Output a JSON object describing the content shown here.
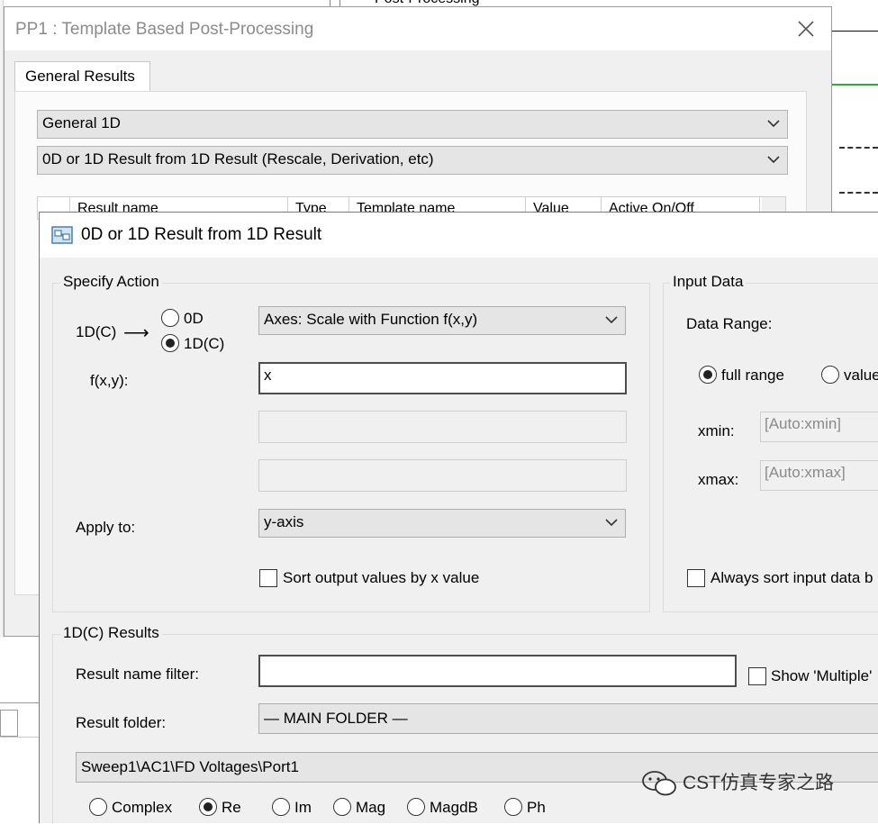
{
  "background": {
    "tree_item": "Post-Processing"
  },
  "pp1": {
    "title": "PP1 : Template Based Post-Processing",
    "tab": "General Results",
    "combo_category": "General 1D",
    "combo_template": "0D or 1D Result from 1D Result (Rescale, Derivation, etc)",
    "grid_columns": [
      "Result name",
      "Type",
      "Template name",
      "Value",
      "Active On/Off"
    ]
  },
  "dialog": {
    "title": "0D or 1D Result from 1D Result",
    "specify_action": {
      "legend": "Specify Action",
      "type_label": "1D(C)",
      "arrow": "⟶",
      "radio_0d": "0D",
      "radio_1dc": "1D(C)",
      "action_value": "Axes: Scale with Function f(x,y)",
      "fxy_label": "f(x,y):",
      "fxy_value": "x",
      "extra_field_1": "",
      "extra_field_2": "",
      "apply_label": "Apply to:",
      "apply_value": "y-axis",
      "sort_label": "Sort output values by x value"
    },
    "input_data": {
      "legend": "Input Data",
      "range_label": "Data Range:",
      "full_range": "full range",
      "value_range": "value",
      "xmin_label": "xmin:",
      "xmin_value": "[Auto:xmin]",
      "xmax_label": "xmax:",
      "xmax_value": "[Auto:xmax]",
      "always_sort_label": "Always sort input data b"
    },
    "results": {
      "legend": "1D(C) Results",
      "filter_label": "Result name filter:",
      "filter_value": "",
      "show_multiple_label": "Show 'Multiple'",
      "folder_label": "Result folder:",
      "folder_value": "— MAIN FOLDER —",
      "selected_result": "Sweep1\\AC1\\FD Voltages\\Port1",
      "modes": [
        "Complex",
        "Re",
        "Im",
        "Mag",
        "MagdB",
        "Ph"
      ],
      "selected_mode": "Re"
    }
  },
  "watermark": "CST仿真专家之路"
}
